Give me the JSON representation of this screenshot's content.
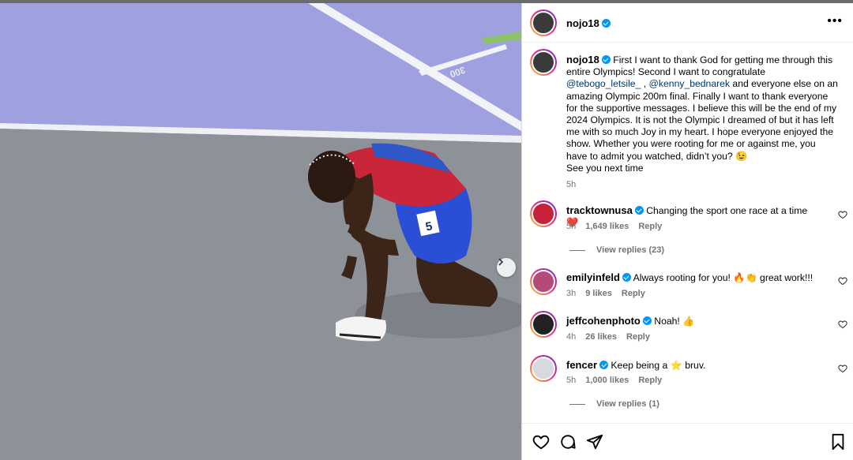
{
  "post": {
    "author": "nojo18",
    "caption_parts": [
      "First I want to thank God for getting me through this entire Olympics! Second I want to congratulate ",
      "@tebogo_letsile_",
      " , ",
      "@kenny_bednarek",
      " and everyone else on an amazing Olympic 200m final. Finally I want to thank everyone for the supportive messages. I believe this will be the end of my 2024 Olympics. It is not the Olympic I dreamed of but it has left me with so much Joy in my heart. I hope everyone enjoyed the show. Whether you were rooting for me or against me, you have to admit you watched, didn’t you? 😉",
      "See you next time"
    ],
    "time": "5h"
  },
  "photo": {
    "track_label": "300",
    "bib_number": "5"
  },
  "comments": [
    {
      "user": "tracktownusa",
      "text": "Changing the sport one race at a time ❤️",
      "time": "5h",
      "likes": "1,649 likes",
      "reply": "Reply",
      "view_replies": "View replies (23)"
    },
    {
      "user": "emilyinfeld",
      "text": "Always rooting for you! 🔥👏 great work!!!",
      "time": "3h",
      "likes": "9 likes",
      "reply": "Reply"
    },
    {
      "user": "jeffcohenphoto",
      "text": "Noah! 👍",
      "time": "4h",
      "likes": "26 likes",
      "reply": "Reply"
    },
    {
      "user": "fencer",
      "text": "Keep being a ⭐ bruv.",
      "time": "5h",
      "likes": "1,000 likes",
      "reply": "Reply",
      "view_replies": "View replies (1)"
    }
  ],
  "header": {
    "more_icon": "more-horizontal-icon"
  },
  "actions": {
    "icons": [
      "heart-icon",
      "comment-icon",
      "share-icon",
      "bookmark-icon"
    ]
  },
  "colors": {
    "verified": "#0095f6",
    "mention": "#00376b",
    "muted": "#737373",
    "track_purple": "#9a9ce0"
  }
}
